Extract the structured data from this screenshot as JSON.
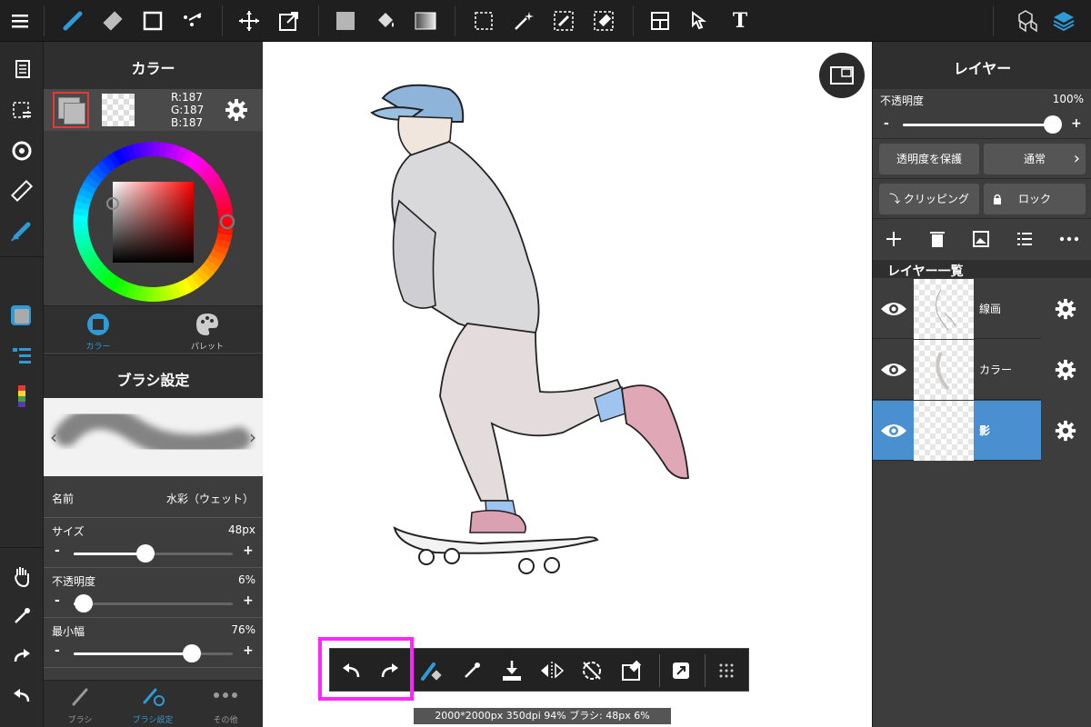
{
  "colors": {
    "accent": "#2e9bd6",
    "selected_layer": "#4a90d0",
    "highlight": "#ff27ff",
    "panel_bg": "#3d3d3d",
    "current_color": "#bbbbbb"
  },
  "top_toolbar": {
    "icons": [
      "menu-icon",
      "brush-icon",
      "eraser-icon",
      "rectangle-icon",
      "blur-dots-icon",
      "move-icon",
      "transform-icon",
      "fill-color-icon",
      "bucket-icon",
      "gradient-icon",
      "select-rect-icon",
      "magic-wand-icon",
      "select-pen-icon",
      "select-eraser-icon",
      "frame-divide-icon",
      "operate-icon",
      "text-icon",
      "material-icon",
      "layers-icon"
    ],
    "text_tool_label": "T"
  },
  "color_panel": {
    "title": "カラー",
    "rgb": {
      "r": "R:187",
      "g": "G:187",
      "b": "B:187"
    },
    "tabs": [
      {
        "label": "カラー",
        "icon": "color-circle-icon",
        "active": true
      },
      {
        "label": "パレット",
        "icon": "palette-icon",
        "active": false
      }
    ]
  },
  "brush_panel": {
    "title": "ブラシ設定",
    "name_label": "名前",
    "name_value": "水彩（ウェット）",
    "size": {
      "label": "サイズ",
      "value": "48px",
      "fraction": 0.45
    },
    "opacity": {
      "label": "不透明度",
      "value": "6%",
      "fraction": 0.06
    },
    "min_width": {
      "label": "最小幅",
      "value": "76%",
      "fraction": 0.74
    },
    "minus": "-",
    "plus": "+",
    "prev_arrow": "‹",
    "next_arrow": "›"
  },
  "bottom_tabs": [
    {
      "label": "ブラシ",
      "icon": "brush-icon",
      "active": false
    },
    {
      "label": "ブラシ設定",
      "icon": "brush-settings-icon",
      "active": true
    },
    {
      "label": "その他",
      "icon": "more-dots-icon",
      "active": false
    }
  ],
  "layer_panel": {
    "title": "レイヤー",
    "opacity_label": "不透明度",
    "opacity_value": "100%",
    "opacity_fraction": 1.0,
    "protect_alpha": "透明度を保護",
    "blend_mode": "通常",
    "clipping": "クリッピング",
    "lock": "ロック",
    "list_title": "レイヤー一覧",
    "layers": [
      {
        "name": "線画",
        "selected": false
      },
      {
        "name": "カラー",
        "selected": false
      },
      {
        "name": "影",
        "selected": true
      }
    ]
  },
  "canvas": {
    "status": "2000*2000px 350dpi 94% ブラシ: 48px 6%"
  },
  "quick_bar": {
    "icons": [
      "undo-icon",
      "redo-icon",
      "brush-swap-icon",
      "eyedropper-icon",
      "save-icon",
      "flip-icon",
      "rotate-reset-icon",
      "clear-layer-icon",
      "fullscreen-icon",
      "grid-icon"
    ]
  }
}
